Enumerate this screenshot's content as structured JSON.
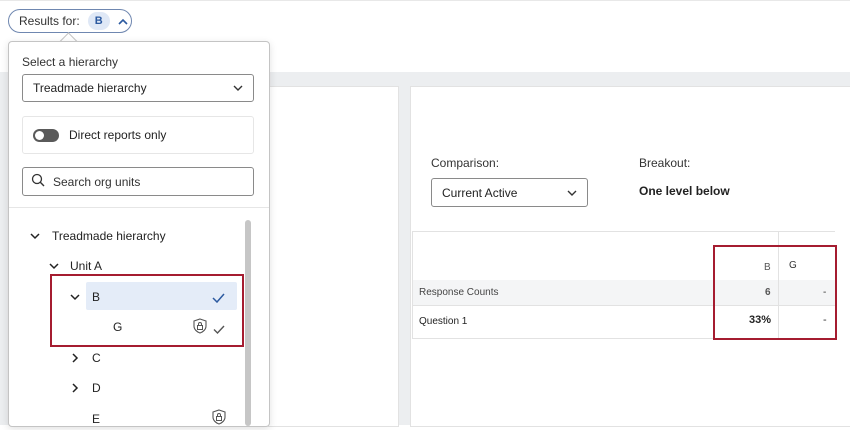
{
  "header": {
    "results_label": "Results for:",
    "selected_unit": "B"
  },
  "dropdown": {
    "hierarchy_label": "Select a hierarchy",
    "hierarchy_value": "Treadmade hierarchy",
    "direct_reports_label": "Direct reports only",
    "direct_reports_on": false,
    "search_placeholder": "Search org units",
    "tree": [
      {
        "label": "Treadmade hierarchy",
        "level": 0,
        "expanded": true
      },
      {
        "label": "Unit A",
        "level": 1,
        "expanded": true
      },
      {
        "label": "B",
        "level": 2,
        "expanded": true,
        "selected": true,
        "checked": true
      },
      {
        "label": "G",
        "level": 3,
        "locked": true,
        "checked": true
      },
      {
        "label": "C",
        "level": 2,
        "expanded": false
      },
      {
        "label": "D",
        "level": 2,
        "expanded": false
      },
      {
        "label": "E",
        "level": 2,
        "locked": true
      }
    ]
  },
  "widget": {
    "comparison_label": "Comparison:",
    "comparison_value": "Current Active",
    "breakout_label": "Breakout:",
    "breakout_value": "One level below",
    "table": {
      "columns": [
        "B",
        "G"
      ],
      "rows": [
        {
          "label": "Response Counts",
          "values": [
            "6",
            "-"
          ]
        },
        {
          "label": "Question 1",
          "values": [
            "33%",
            "-"
          ]
        }
      ]
    }
  },
  "colors": {
    "accent": "#2c5aa0",
    "highlight": "#a51c30",
    "selected_row": "#e4ecf8"
  }
}
